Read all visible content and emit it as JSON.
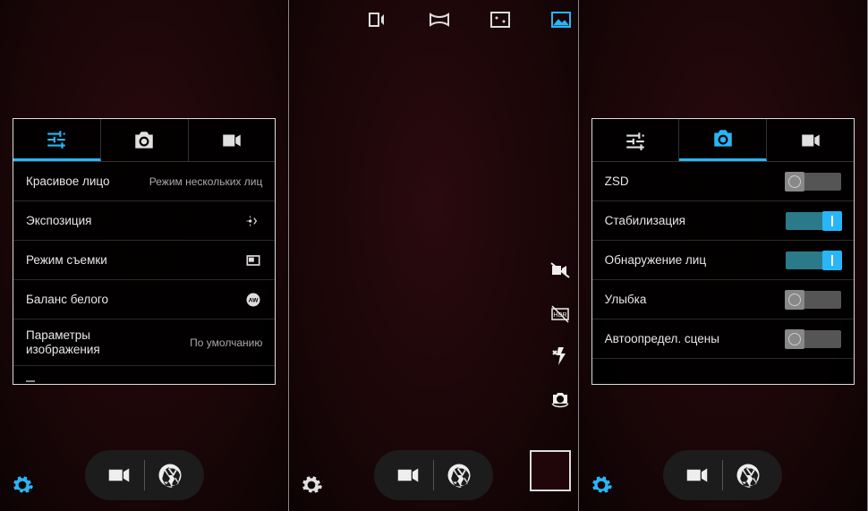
{
  "screen1": {
    "activeTab": 0,
    "rows": [
      {
        "label": "Красивое лицо",
        "value": "Режим нескольких лиц"
      },
      {
        "label": "Экспозиция",
        "icon": "exposure"
      },
      {
        "label": "Режим съемки",
        "icon": "frame"
      },
      {
        "label": "Баланс белого",
        "icon": "awb"
      },
      {
        "label_line1": "Параметры",
        "label_line2": "изображения",
        "value": "По умолчанию"
      }
    ]
  },
  "screen3": {
    "activeTab": 1,
    "rows": [
      {
        "label": "ZSD",
        "toggle": false
      },
      {
        "label": "Стабилизация",
        "toggle": true
      },
      {
        "label": "Обнаружение лиц",
        "toggle": true
      },
      {
        "label": "Улыбка",
        "toggle": false
      },
      {
        "label": "Автоопредел. сцены",
        "toggle": false
      }
    ]
  }
}
